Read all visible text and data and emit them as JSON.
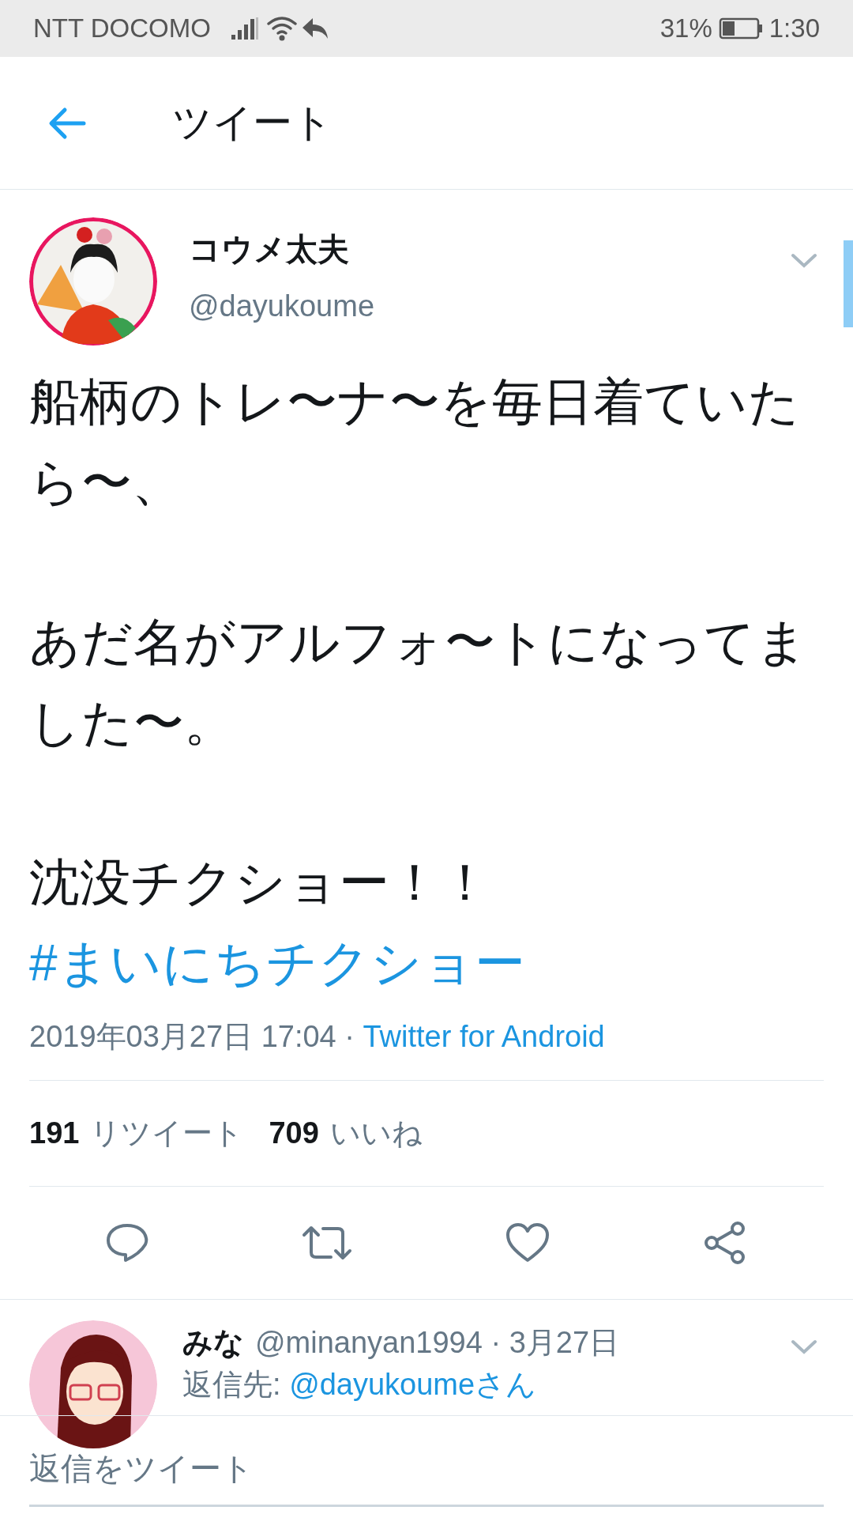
{
  "status_bar": {
    "carrier": "NTT DOCOMO",
    "battery": "31%",
    "time": "1:30"
  },
  "header": {
    "title": "ツイート"
  },
  "tweet": {
    "name": "コウメ太夫",
    "handle": "@dayukoume",
    "paragraphs": [
      [
        {
          "kind": "text",
          "text": "船柄のトレ〜ナ〜を毎日着ていたら〜、"
        }
      ],
      [
        {
          "kind": "text",
          "text": "あだ名がアルフォ〜トになってました〜。"
        }
      ],
      [
        {
          "kind": "text",
          "text": "沈没チクショー！！　"
        },
        {
          "kind": "hashtag",
          "text": "#まいにちチクショー"
        }
      ]
    ],
    "timestamp": "2019年03月27日 17:04 · ",
    "source": "Twitter for Android",
    "stats": [
      {
        "count": "191",
        "label": "リツイート"
      },
      {
        "count": "709",
        "label": "いいね"
      }
    ]
  },
  "reply": {
    "name": "みな",
    "meta": "@minanyan1994 · 3月27日",
    "reply_to_label": "返信先: ",
    "reply_to": "@dayukoumeさん"
  },
  "compose": {
    "placeholder": "返信をツイート"
  }
}
